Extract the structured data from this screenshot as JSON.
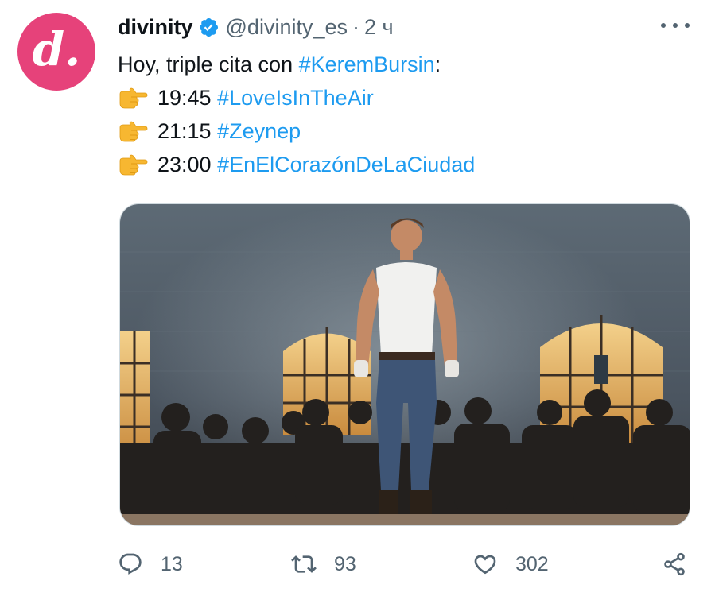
{
  "author": {
    "display_name": "divinity",
    "logo_text": "d.",
    "handle": "@divinity_es",
    "separator": "·",
    "time": "2 ч",
    "verified": true,
    "brand_color": "#e6427a"
  },
  "tweet": {
    "intro_text": "Hoy, triple cita con ",
    "intro_hashtag": "#KeremBursin",
    "intro_suffix": ":",
    "schedule": [
      {
        "emoji": "backhand-index-pointing-right",
        "time": "19:45",
        "hashtag": "#LoveIsInTheAir"
      },
      {
        "emoji": "backhand-index-pointing-right",
        "time": "21:15",
        "hashtag": "#Zeynep"
      },
      {
        "emoji": "backhand-index-pointing-right",
        "time": "23:00",
        "hashtag": "#EnElCorazónDeLaCiudad"
      }
    ]
  },
  "actions": {
    "replies": "13",
    "retweets": "93",
    "likes": "302"
  },
  "colors": {
    "link": "#1d9bf0",
    "muted": "#536471",
    "text": "#0f1419"
  }
}
